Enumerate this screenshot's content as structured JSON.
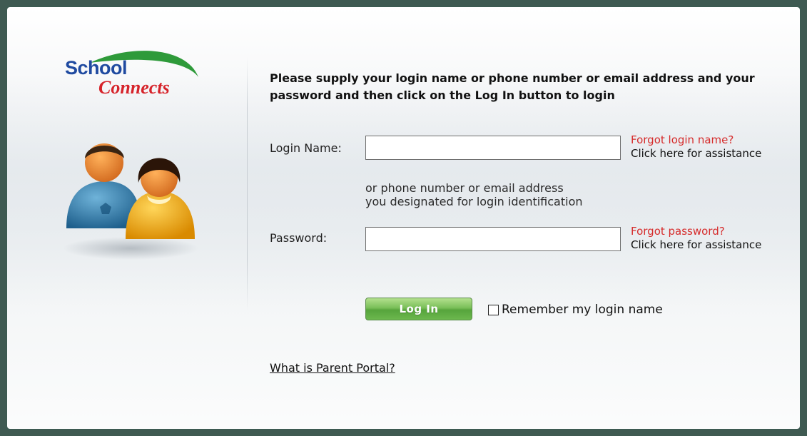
{
  "brand": {
    "logo_line1": "School",
    "logo_line2": "Connects",
    "colors": {
      "blue": "#1f4aa0",
      "red": "#d6232a",
      "green": "#2e9a3a"
    }
  },
  "intro_text": "Please supply your login name or phone number or email address and your password and then click on the Log In button to login",
  "login_name": {
    "label": "Login Name:",
    "value": "",
    "forgot_link": "Forgot login name?",
    "assist_text": "Click here for assistance",
    "hint_line1": "or phone number or email address",
    "hint_line2": "you designated for login identification"
  },
  "password": {
    "label": "Password:",
    "value": "",
    "forgot_link": "Forgot password?",
    "assist_text": "Click here for assistance"
  },
  "actions": {
    "login_button": "Log In",
    "remember_label": "Remember my login name",
    "remember_checked": false
  },
  "footer_link": "What is Parent Portal?",
  "icons": [
    "school-connects-logo",
    "parents-illustration-icon"
  ]
}
